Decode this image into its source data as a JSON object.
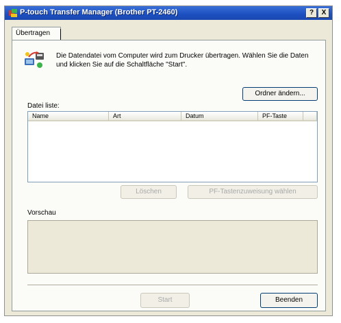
{
  "window": {
    "title": "P-touch Transfer Manager (Brother PT-2460)",
    "help_label": "?",
    "close_label": "X"
  },
  "tab": {
    "label": "Übertragen"
  },
  "info": {
    "text": "Die Datendatei vom Computer wird zum Drucker übertragen. Wählen Sie die Daten und klicken Sie auf die Schaltfläche \"Start\"."
  },
  "buttons": {
    "change_folder": "Ordner ändern...",
    "delete": "Löschen",
    "select_pf_key": "PF-Tastenzuweisung wählen",
    "start": "Start",
    "exit": "Beenden"
  },
  "file_list": {
    "label": "Datei liste:",
    "columns": [
      "Name",
      "Art",
      "Datum",
      "PF-Taste"
    ],
    "rows": []
  },
  "preview": {
    "label": "Vorschau"
  },
  "colors": {
    "title_bar": "#1c4fc0",
    "dialog_bg": "#ece9d8"
  }
}
